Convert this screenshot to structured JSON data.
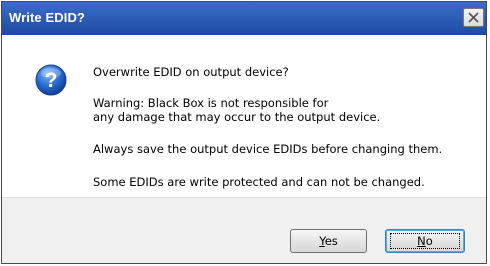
{
  "window": {
    "title": "Write EDID?",
    "close_glyph": "✕"
  },
  "dialog": {
    "icon": "question-icon",
    "lines": [
      "Overwrite EDID on output device?",
      "Warning: Black Box is not responsible for",
      "any damage that may occur to the output device.",
      "Always save the output device EDIDs before changing them.",
      "Some EDIDs are write protected and can not be changed."
    ]
  },
  "buttons": {
    "yes": {
      "mnemonic": "Y",
      "rest": "es"
    },
    "no": {
      "mnemonic": "N",
      "rest": "o"
    }
  },
  "colors": {
    "titlebar": "#2a5bb8",
    "title_text": "#ffffff",
    "footer": "#f0f0f0",
    "icon_blue": "#1f63c8",
    "default_button_border": "#3c7fb1"
  }
}
